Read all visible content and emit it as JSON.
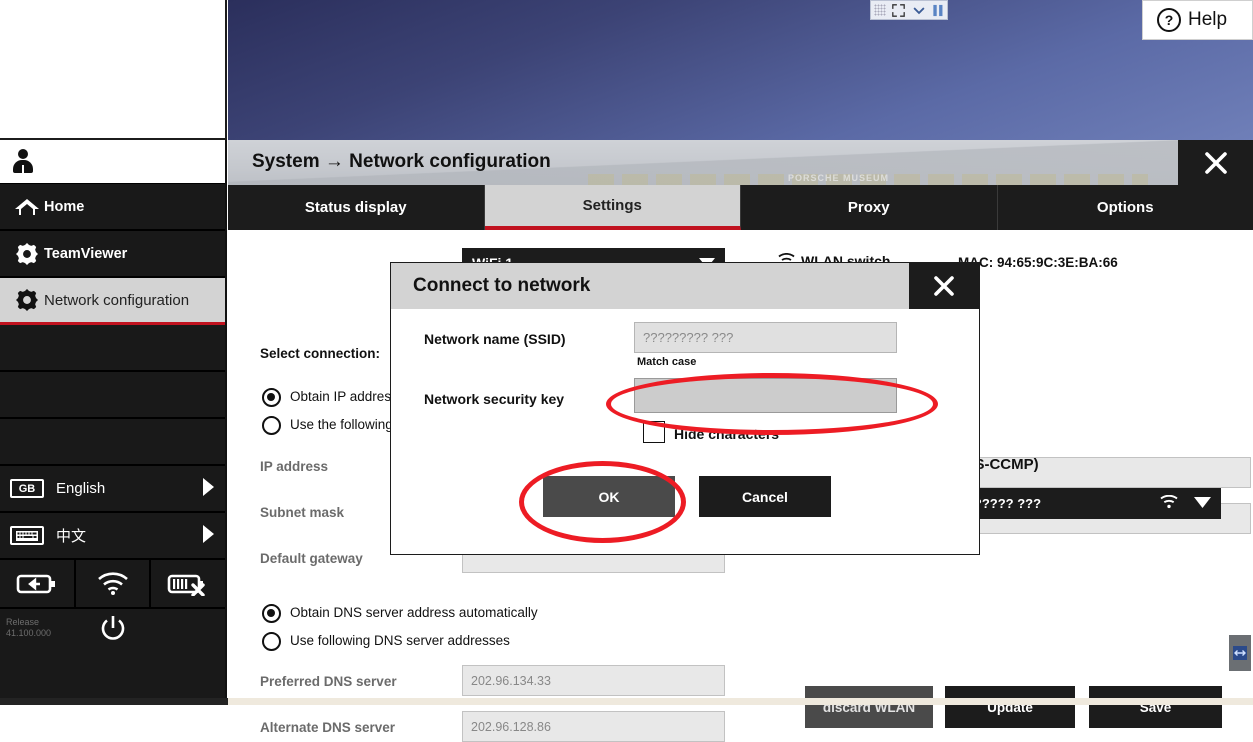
{
  "desktop": {
    "tv_toolbar": {
      "grip": "drag-grip",
      "fullscreen": "fullscreen-icon",
      "chevron": "chevron-down-icon",
      "pause": "pause-icon"
    },
    "help": {
      "label": "Help",
      "icon": "question-mark-icon"
    }
  },
  "sidebar": {
    "user_icon": "person-icon",
    "items": [
      {
        "label": "Home",
        "icon": "home-icon",
        "active": false
      },
      {
        "label": "TeamViewer",
        "icon": "gear-icon",
        "active": false
      },
      {
        "label": "Network configuration",
        "icon": "gear-icon",
        "active": true
      }
    ],
    "languages": [
      {
        "label": "English",
        "badge": "GB",
        "icon": "flag-badge-icon",
        "arrow": "chevron-right-icon"
      },
      {
        "label": "中文",
        "badge": "",
        "icon": "keyboard-icon",
        "arrow": "chevron-right-icon"
      }
    ],
    "status_icons": [
      "battery-charging-icon",
      "wifi-icon",
      "battery-error-icon"
    ],
    "power_icon": "power-icon",
    "release_line1": "Release",
    "release_line2": "41.100.000"
  },
  "window": {
    "title": "System → Network configuration",
    "close_icon": "close-icon",
    "banner_caption": "PORSCHE MUSEUM",
    "tabs": [
      {
        "label": "Status display",
        "active": false
      },
      {
        "label": "Settings",
        "active": true
      },
      {
        "label": "Proxy",
        "active": false
      },
      {
        "label": "Options",
        "active": false
      }
    ]
  },
  "settings": {
    "select_connection_label": "Select connection:",
    "connection_value": "WiFi 1",
    "connection_dropdown_icon": "chevron-down-icon",
    "wlan_switch_label": "WLAN switch",
    "wlan_switch_icon": "wifi-icon",
    "mac_label": "MAC:",
    "mac_value": "94:65:9C:3E:BA:66",
    "ip_mode": [
      {
        "label": "Obtain IP address automatically",
        "selected": true
      },
      {
        "label": "Use the following IP address",
        "selected": false
      }
    ],
    "ip_fields": [
      {
        "label": "IP address",
        "value": ""
      },
      {
        "label": "Subnet mask",
        "value": ""
      },
      {
        "label": "Default gateway",
        "value": ""
      }
    ],
    "dns_mode": [
      {
        "label": "Obtain DNS server address automatically",
        "selected": true
      },
      {
        "label": "Use following DNS server addresses",
        "selected": false
      }
    ],
    "dns_fields": [
      {
        "label": "Preferred DNS server",
        "value": "202.96.134.33"
      },
      {
        "label": "Alternate DNS server",
        "value": "202.96.128.86"
      }
    ],
    "security_text": "-PSK with AES-CCMP)",
    "wifi_value": "??????? ???",
    "wifi_signal_icon": "wifi-icon",
    "wifi_dropdown_icon": "chevron-down-icon",
    "buttons": {
      "discard": "discard WLAN",
      "update": "Update",
      "save": "Save"
    }
  },
  "dialog": {
    "title": "Connect to network",
    "close_icon": "close-icon",
    "ssid_label": "Network name (SSID)",
    "ssid_value": "????????? ???",
    "match_case_label": "Match case",
    "key_label": "Network security key",
    "key_value": "",
    "hide_characters_label": "Hide characters",
    "hide_characters_checked": false,
    "ok_label": "OK",
    "cancel_label": "Cancel"
  },
  "annotations": {
    "color": "#ed1c24",
    "highlights": [
      "network-security-key-field",
      "ok-button"
    ]
  },
  "scrollbar": {
    "thumb_icon": "resize-handle-icon"
  }
}
